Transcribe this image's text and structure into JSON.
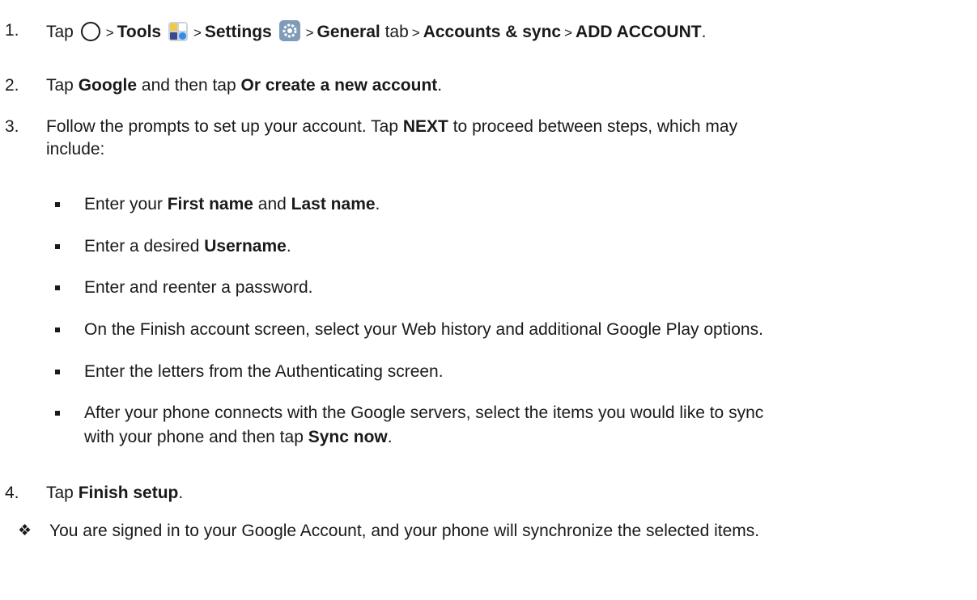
{
  "steps": [
    {
      "num": "1.",
      "tap": "Tap",
      "home_icon": "home-circle-icon",
      "sep": ">",
      "tools": "Tools",
      "tools_icon": "tools-folder-icon",
      "settings": "Settings",
      "settings_icon": "settings-gear-icon",
      "general": "General",
      "tab_word": "tab",
      "accounts": "Accounts & sync",
      "add_account": "ADD ACCOUNT",
      "period": "."
    },
    {
      "num": "2.",
      "tap": "Tap",
      "google": "Google",
      "and_then": "and then tap",
      "create": "Or create a new account",
      "period": "."
    },
    {
      "num": "3.",
      "pre": "Follow the prompts to set up your account. Tap",
      "next": "NEXT",
      "post_line1": "to proceed between steps, which may",
      "line2": "include:"
    },
    {
      "num": "4.",
      "tap": "Tap",
      "finish": "Finish setup",
      "period": "."
    }
  ],
  "bullets": [
    {
      "pre": "Enter your",
      "b1": "First name",
      "mid": "and",
      "b2": "Last name",
      "end": "."
    },
    {
      "pre": "Enter a desired",
      "b1": "Username",
      "end": "."
    },
    {
      "text": "Enter and reenter a password."
    },
    {
      "text": "On the Finish account screen, select your Web history and additional Google Play options."
    },
    {
      "text": "Enter the letters from the Authenticating screen."
    },
    {
      "line1": "After your phone connects with the Google servers, select the items you would like to sync",
      "line2_pre": "with your phone and then tap",
      "line2_bold": "Sync now",
      "end": "."
    }
  ],
  "note": {
    "icon": "diamond-bullet-icon",
    "text": "You are signed in to your Google Account, and your phone will synchronize the selected items."
  }
}
